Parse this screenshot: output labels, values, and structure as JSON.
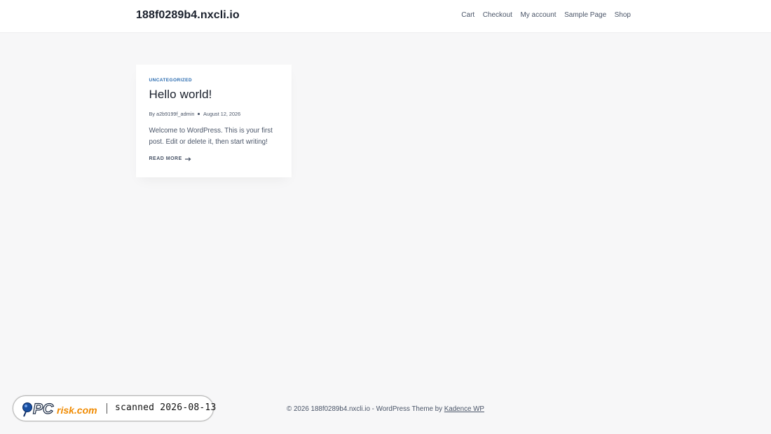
{
  "header": {
    "site_title": "188f0289b4.nxcli.io",
    "nav": [
      {
        "label": "Cart"
      },
      {
        "label": "Checkout"
      },
      {
        "label": "My account"
      },
      {
        "label": "Sample Page"
      },
      {
        "label": "Shop"
      }
    ]
  },
  "post": {
    "category": "UNCATEGORIZED",
    "title": "Hello world!",
    "author_prefix": "By",
    "author": "a2b9199f_admin",
    "date": "August 12, 2026",
    "excerpt": "Welcome to WordPress. This is your first post. Edit or delete it, then start writing!",
    "read_more": "READ MORE"
  },
  "footer": {
    "copyright": "© 2026 188f0289b4.nxcli.io - WordPress Theme by",
    "theme_link": "Kadence WP"
  },
  "badge": {
    "logo_text": "PCrisk.com",
    "scan_text": "scanned 2026-08-13"
  },
  "colors": {
    "background": "#f7f7f8",
    "accent": "#2b6cb0",
    "text": "#4a5568",
    "heading": "#1a202c",
    "logo_blue": "#1a4fa0",
    "logo_orange": "#f08a00"
  }
}
